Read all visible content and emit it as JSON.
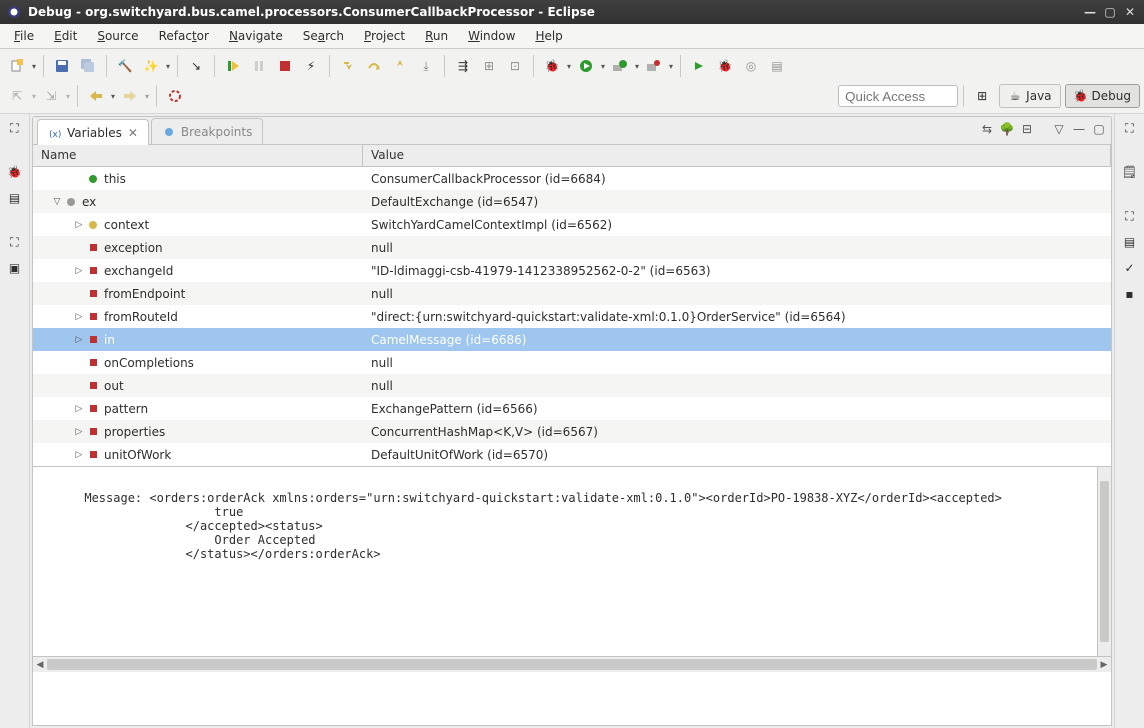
{
  "window": {
    "title": "Debug - org.switchyard.bus.camel.processors.ConsumerCallbackProcessor - Eclipse"
  },
  "menubar": [
    "File",
    "Edit",
    "Source",
    "Refactor",
    "Navigate",
    "Search",
    "Project",
    "Run",
    "Window",
    "Help"
  ],
  "quick_access_placeholder": "Quick Access",
  "perspectives": {
    "java": "Java",
    "debug": "Debug"
  },
  "tabs": {
    "variables": "Variables",
    "breakpoints": "Breakpoints"
  },
  "columns": {
    "name": "Name",
    "value": "Value"
  },
  "rows": [
    {
      "depth": 1,
      "twist": "",
      "icon": "green",
      "name": "this",
      "value": "ConsumerCallbackProcessor  (id=6684)"
    },
    {
      "depth": 0,
      "twist": "▽",
      "icon": "grey",
      "name": "ex",
      "value": "DefaultExchange  (id=6547)"
    },
    {
      "depth": 1,
      "twist": "▷",
      "icon": "yel",
      "name": "context",
      "value": "SwitchYardCamelContextImpl  (id=6562)"
    },
    {
      "depth": 1,
      "twist": "",
      "icon": "red",
      "name": "exception",
      "value": "null"
    },
    {
      "depth": 1,
      "twist": "▷",
      "icon": "red",
      "name": "exchangeId",
      "value": "\"ID-ldimaggi-csb-41979-1412338952562-0-2\" (id=6563)"
    },
    {
      "depth": 1,
      "twist": "",
      "icon": "red",
      "name": "fromEndpoint",
      "value": "null"
    },
    {
      "depth": 1,
      "twist": "▷",
      "icon": "red",
      "name": "fromRouteId",
      "value": "\"direct:{urn:switchyard-quickstart:validate-xml:0.1.0}OrderService\" (id=6564)"
    },
    {
      "depth": 1,
      "twist": "▷",
      "icon": "red",
      "name": "in",
      "value": "CamelMessage  (id=6686)",
      "selected": true
    },
    {
      "depth": 1,
      "twist": "",
      "icon": "red",
      "name": "onCompletions",
      "value": "null"
    },
    {
      "depth": 1,
      "twist": "",
      "icon": "red",
      "name": "out",
      "value": "null"
    },
    {
      "depth": 1,
      "twist": "▷",
      "icon": "red",
      "name": "pattern",
      "value": "ExchangePattern  (id=6566)"
    },
    {
      "depth": 1,
      "twist": "▷",
      "icon": "red",
      "name": "properties",
      "value": "ConcurrentHashMap<K,V>  (id=6567)"
    },
    {
      "depth": 1,
      "twist": "▷",
      "icon": "red",
      "name": "unitOfWork",
      "value": "DefaultUnitOfWork  (id=6570)"
    }
  ],
  "detail_text": "Message: <orders:orderAck xmlns:orders=\"urn:switchyard-quickstart:validate-xml:0.1.0\"><orderId>PO-19838-XYZ</orderId><accepted>\n                        true\n                    </accepted><status>\n                        Order Accepted\n                    </status></orders:orderAck>"
}
